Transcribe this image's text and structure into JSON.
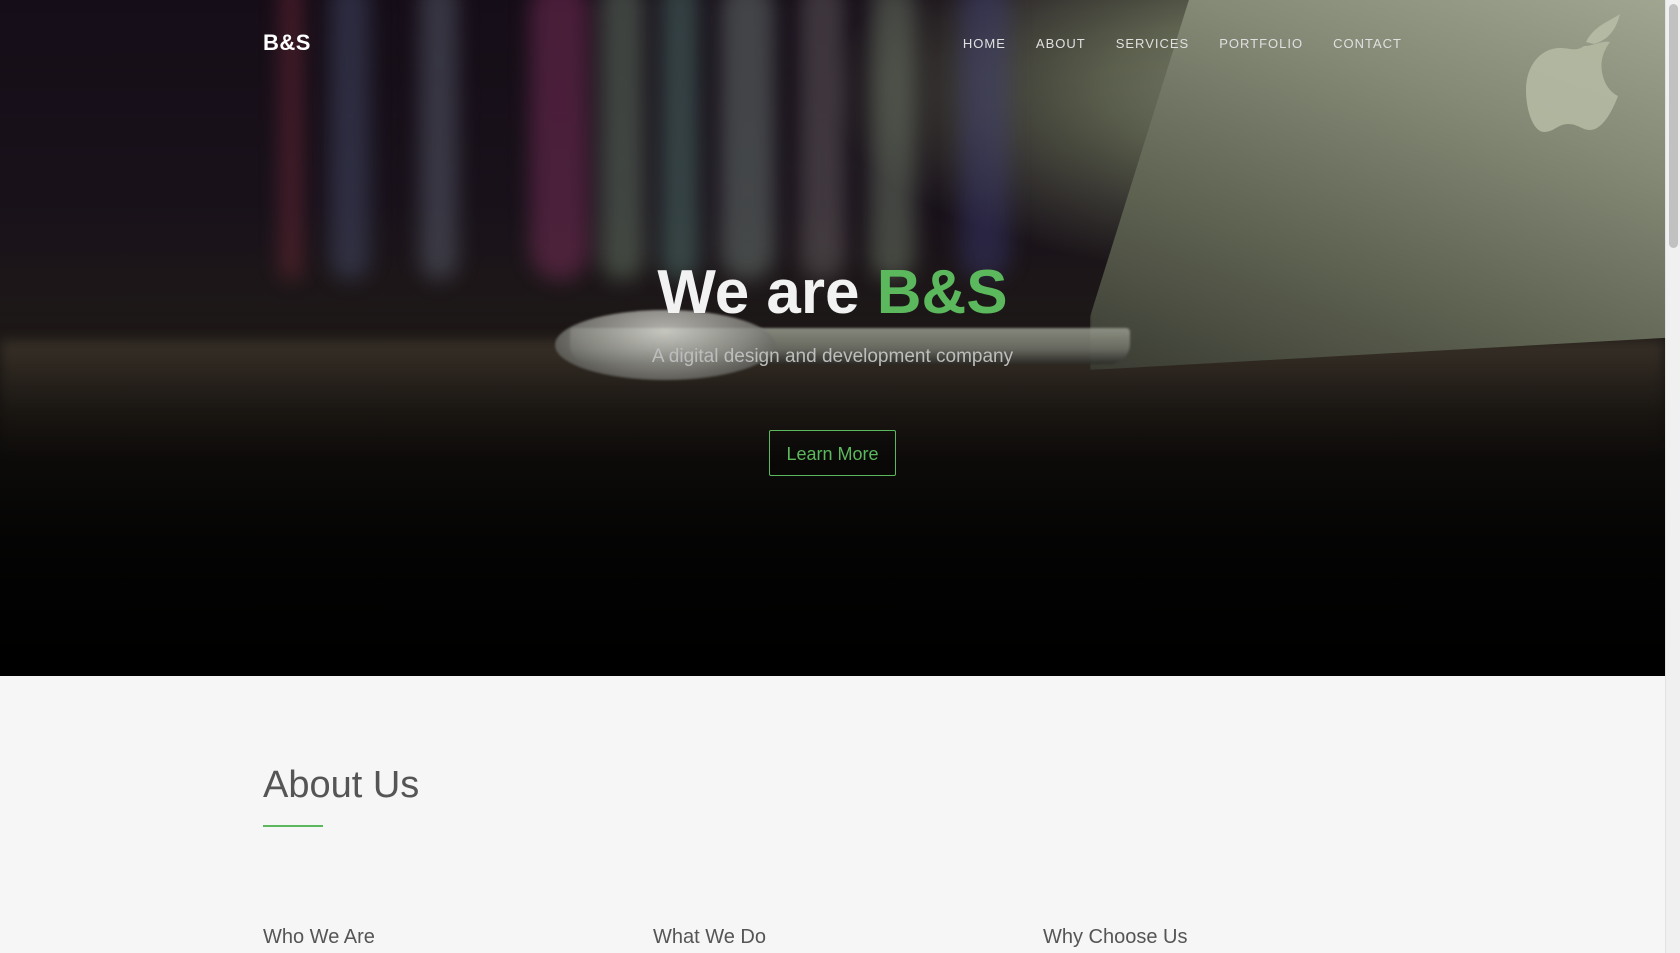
{
  "nav": {
    "brand": "B&S",
    "links": [
      "HOME",
      "ABOUT",
      "SERVICES",
      "PORTFOLIO",
      "CONTACT"
    ]
  },
  "hero": {
    "title_prefix": "We are ",
    "title_accent": "B&S",
    "subtitle": "A digital design and development company",
    "cta_label": "Learn More",
    "background_image_subject": "laptop-and-mouse-on-desk",
    "logo_icon": "apple-logo-icon"
  },
  "about": {
    "title": "About Us",
    "columns": [
      "Who We Are",
      "What We Do",
      "Why Choose Us"
    ]
  },
  "colors": {
    "accent": "#5cb85c",
    "section_bg": "#f6f6f6",
    "heading_text": "#555555"
  }
}
